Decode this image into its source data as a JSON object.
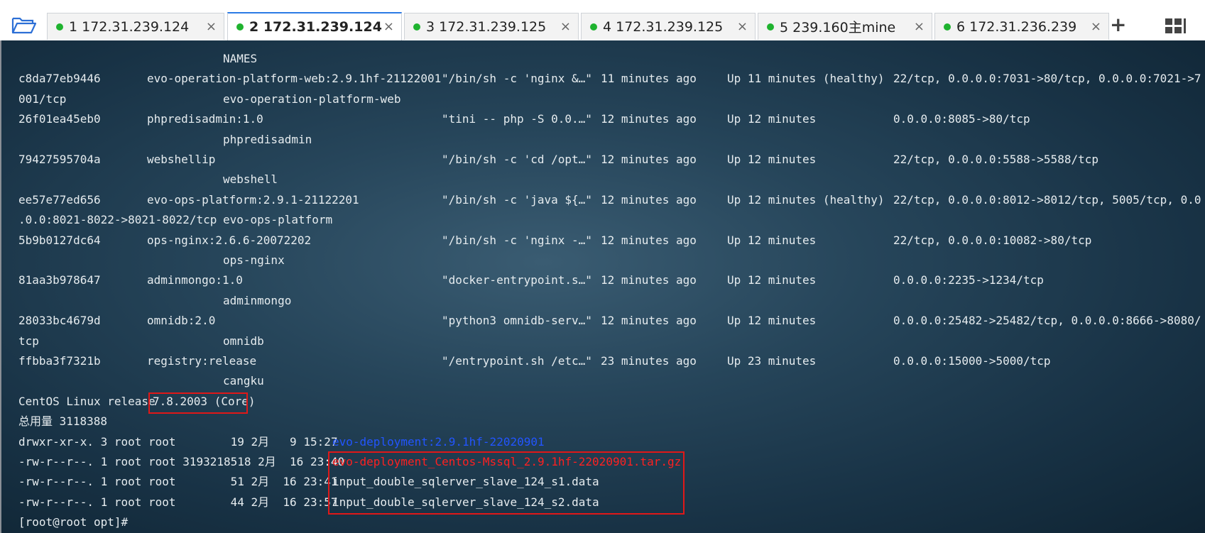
{
  "tabs": [
    {
      "label": "1 172.31.239.124",
      "active": false
    },
    {
      "label": "2 172.31.239.124",
      "active": true
    },
    {
      "label": "3 172.31.239.125",
      "active": false
    },
    {
      "label": "4 172.31.239.125",
      "active": false
    },
    {
      "label": "5 239.160主mine",
      "active": false
    },
    {
      "label": "6 172.31.236.239",
      "active": false
    }
  ],
  "tab_close_glyph": "×",
  "add_tab_glyph": "+",
  "colors": {
    "tab_dot": "#1fb32f",
    "active_accent": "#2c7be5",
    "highlight_red": "#e01818",
    "dir_blue": "#2255ff"
  },
  "icons": {
    "open": "folder-open-icon",
    "add": "plus-icon",
    "layout": "grid-layout-icon"
  },
  "terminal": {
    "header_names": "NAMES",
    "containers": [
      {
        "id": "c8da77eb9446",
        "image": "evo-operation-platform-web:2.9.1hf-21122001",
        "command": "\"/bin/sh -c 'nginx &…\"",
        "created": "11 minutes ago",
        "status": "Up 11 minutes (healthy)",
        "ports_line1": "22/tcp, 0.0.0.0:7031->80/tcp, 0.0.0.0:7021->7",
        "ports_line2": "001/tcp",
        "name": "evo-operation-platform-web"
      },
      {
        "id": "26f01ea45eb0",
        "image": "phpredisadmin:1.0",
        "command": "\"tini -- php -S 0.0.…\"",
        "created": "12 minutes ago",
        "status": "Up 12 minutes",
        "ports_line1": "0.0.0.0:8085->80/tcp",
        "ports_line2": "",
        "name": "phpredisadmin"
      },
      {
        "id": "79427595704a",
        "image": "webshellip",
        "command": "\"/bin/sh -c 'cd /opt…\"",
        "created": "12 minutes ago",
        "status": "Up 12 minutes",
        "ports_line1": "22/tcp, 0.0.0.0:5588->5588/tcp",
        "ports_line2": "",
        "name": "webshell"
      },
      {
        "id": "ee57e77ed656",
        "image": "evo-ops-platform:2.9.1-21122201",
        "command": "\"/bin/sh -c 'java ${…\"",
        "created": "12 minutes ago",
        "status": "Up 12 minutes (healthy)",
        "ports_line1": "22/tcp, 0.0.0.0:8012->8012/tcp, 5005/tcp, 0.0",
        "ports_line2": ".0.0:8021-8022->8021-8022/tcp",
        "name": "evo-ops-platform"
      },
      {
        "id": "5b9b0127dc64",
        "image": "ops-nginx:2.6.6-20072202",
        "command": "\"/bin/sh -c 'nginx -…\"",
        "created": "12 minutes ago",
        "status": "Up 12 minutes",
        "ports_line1": "22/tcp, 0.0.0.0:10082->80/tcp",
        "ports_line2": "",
        "name": "ops-nginx"
      },
      {
        "id": "81aa3b978647",
        "image": "adminmongo:1.0",
        "command": "\"docker-entrypoint.s…\"",
        "created": "12 minutes ago",
        "status": "Up 12 minutes",
        "ports_line1": "0.0.0.0:2235->1234/tcp",
        "ports_line2": "",
        "name": "adminmongo"
      },
      {
        "id": "28033bc4679d",
        "image": "omnidb:2.0",
        "command": "\"python3 omnidb-serv…\"",
        "created": "12 minutes ago",
        "status": "Up 12 minutes",
        "ports_line1": "0.0.0.0:25482->25482/tcp, 0.0.0.0:8666->8080/",
        "ports_line2": "tcp",
        "name": "omnidb"
      },
      {
        "id": "ffbba3f7321b",
        "image": "registry:release",
        "command": "\"/entrypoint.sh /etc…\"",
        "created": "23 minutes ago",
        "status": "Up 23 minutes",
        "ports_line1": "0.0.0.0:15000->5000/tcp",
        "ports_line2": "",
        "name": "cangku"
      }
    ],
    "release_prefix": "CentOS Linux release ",
    "release_version": "7.8.2003 (Core)",
    "total": "总用量 3118388",
    "files": [
      {
        "prefix": "drwxr-xr-x. 3 root root        19 2月   9 15:27 ",
        "name": "evo-deployment:2.9.1hf-22020901",
        "style": "blue"
      },
      {
        "prefix": "-rw-r--r--. 1 root root 3193218518 2月  16 23:40 ",
        "name": "evo-deployment_Centos-Mssql_2.9.1hf-22020901.tar.gz",
        "style": "red"
      },
      {
        "prefix": "-rw-r--r--. 1 root root        51 2月  16 23:41 ",
        "name": "input_double_sqlerver_slave_124_s1.data",
        "style": "plain"
      },
      {
        "prefix": "-rw-r--r--. 1 root root        44 2月  16 23:57 ",
        "name": "input_double_sqlerver_slave_124_s2.data",
        "style": "plain"
      }
    ],
    "prompt": "[root@root opt]# "
  }
}
